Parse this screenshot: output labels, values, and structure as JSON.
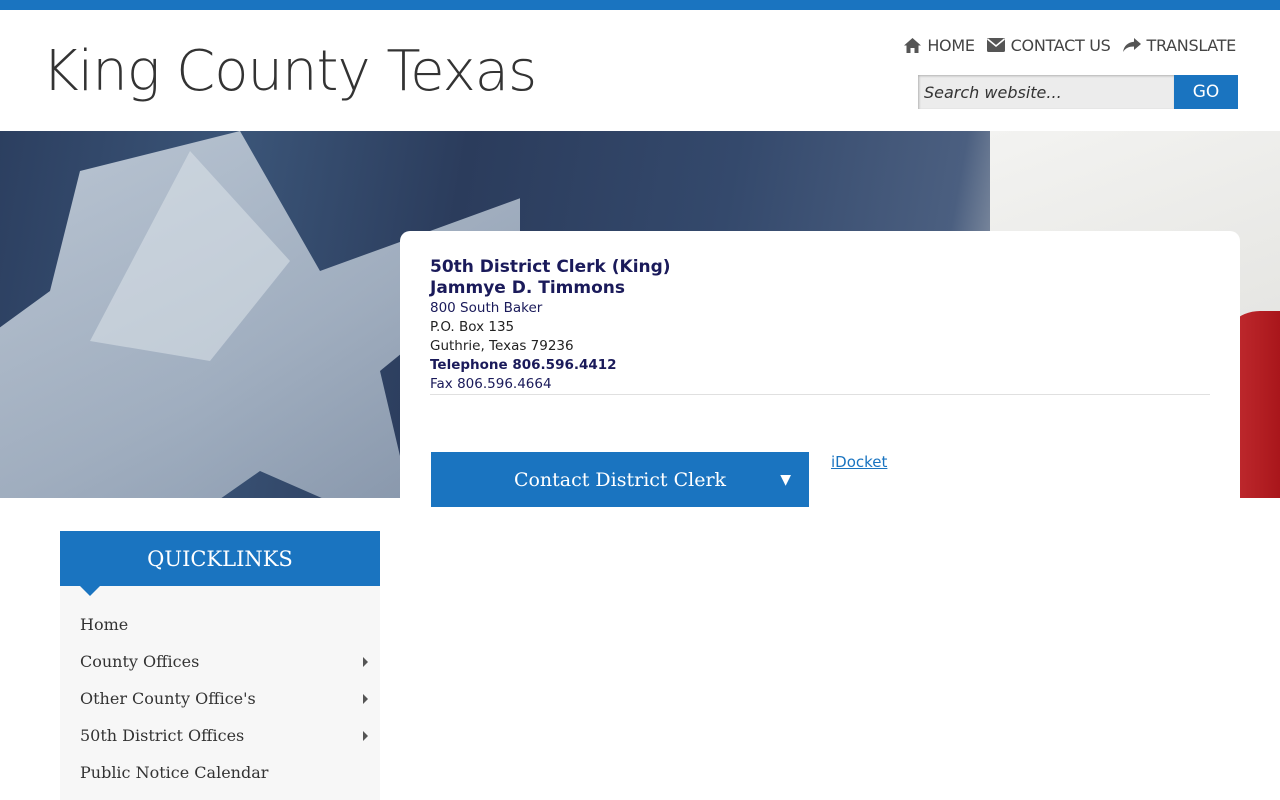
{
  "site": {
    "title": "King County Texas"
  },
  "topnav": {
    "items": [
      {
        "label": "HOME",
        "icon": "home-icon"
      },
      {
        "label": "CONTACT US",
        "icon": "envelope-icon"
      },
      {
        "label": "TRANSLATE",
        "icon": "share-arrow-icon"
      }
    ]
  },
  "search": {
    "placeholder": "Search website...",
    "button_label": "GO"
  },
  "office": {
    "title": "50th District Clerk (King)",
    "person": "Jammye D. Timmons",
    "address_line1": "800 South Baker",
    "address_line2": "P.O. Box 135",
    "address_line3": "Guthrie, Texas 79236",
    "telephone": "Telephone 806.596.4412",
    "fax": "Fax 806.596.4664"
  },
  "actions": {
    "contact_button": "Contact District Clerk",
    "contact_caret": "▼",
    "idocket_link": "iDocket"
  },
  "quicklinks": {
    "heading": "QUICKLINKS",
    "items": [
      {
        "label": "Home",
        "has_submenu": false
      },
      {
        "label": "County Offices",
        "has_submenu": true
      },
      {
        "label": "Other County Office's",
        "has_submenu": true
      },
      {
        "label": "50th District Offices",
        "has_submenu": true
      },
      {
        "label": "Public Notice Calendar",
        "has_submenu": false
      }
    ]
  },
  "colors": {
    "brand_blue": "#1a74c0",
    "navy_text": "#1a1a5a"
  }
}
